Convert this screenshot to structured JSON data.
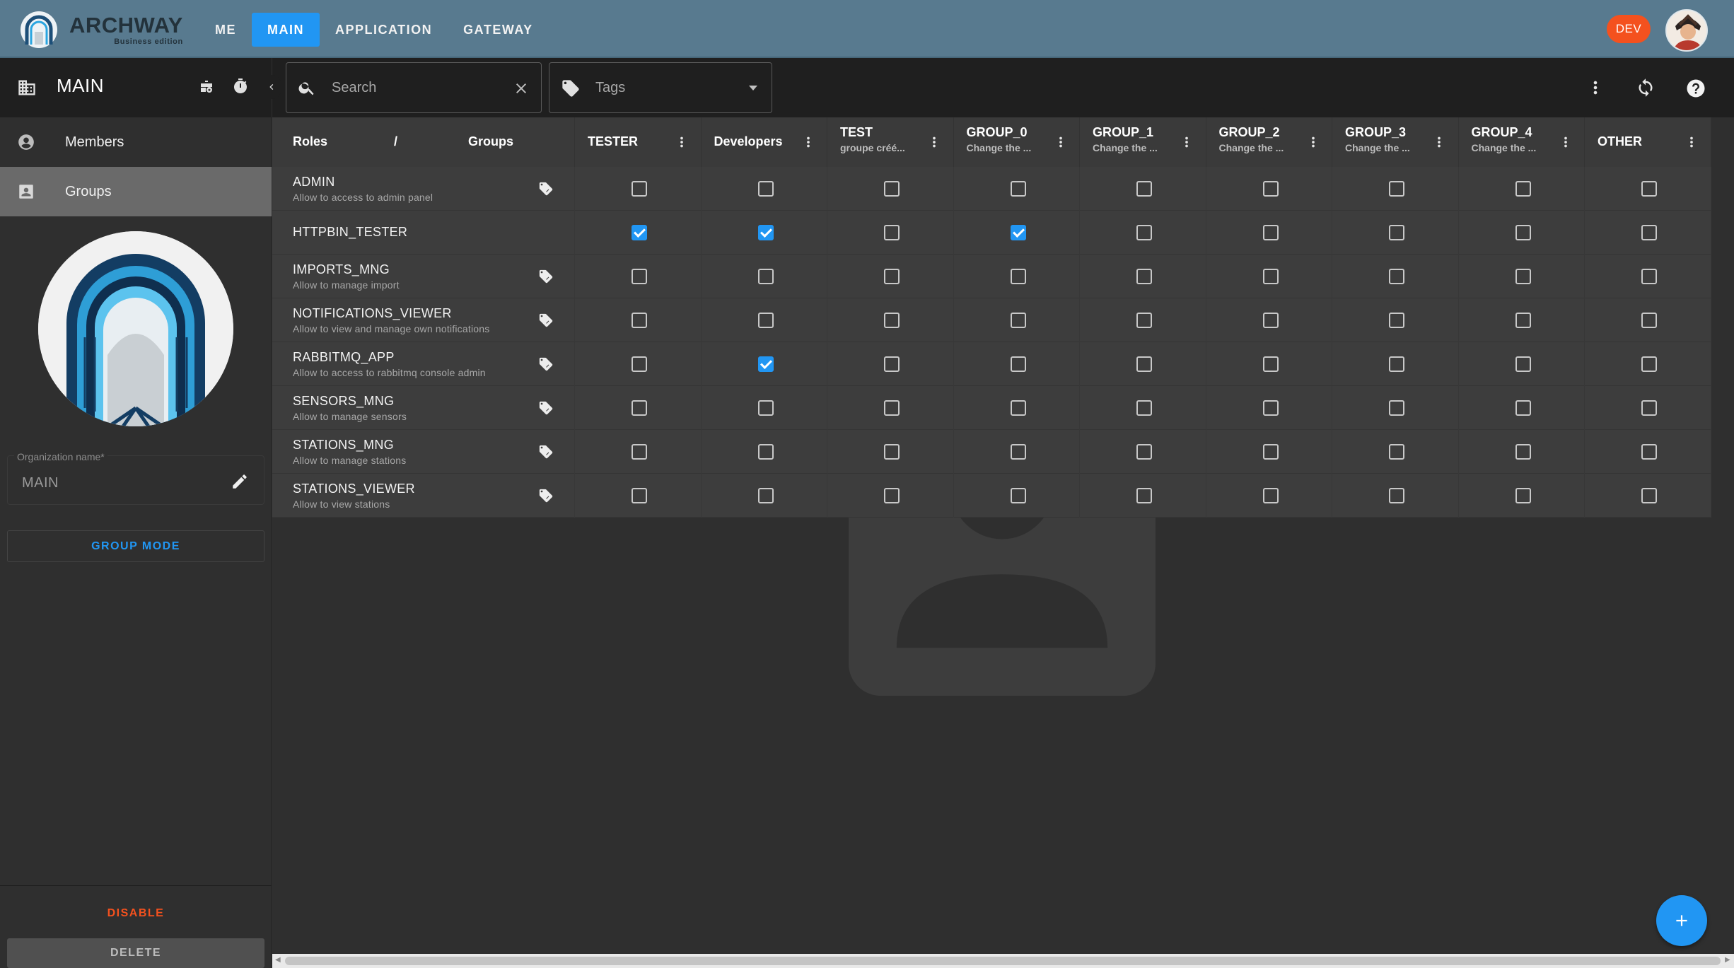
{
  "brand": {
    "name": "ARCHWAY",
    "edition": "Business edition"
  },
  "nav": [
    {
      "label": "ME",
      "active": false
    },
    {
      "label": "MAIN",
      "active": true
    },
    {
      "label": "APPLICATION",
      "active": false
    },
    {
      "label": "GATEWAY",
      "active": false
    }
  ],
  "env_badge": "DEV",
  "sidebar": {
    "title": "MAIN",
    "menu": [
      {
        "label": "Members",
        "icon": "account-circle-icon",
        "active": false
      },
      {
        "label": "Groups",
        "icon": "group-badge-icon",
        "active": true
      }
    ],
    "org_field": {
      "label": "Organization name*",
      "value": "MAIN"
    },
    "group_mode_label": "GROUP MODE",
    "disable_label": "DISABLE",
    "delete_label": "DELETE"
  },
  "toolbar": {
    "search_placeholder": "Search",
    "tags_label": "Tags"
  },
  "table": {
    "corner": {
      "roles": "Roles",
      "separator": "/",
      "groups": "Groups"
    },
    "groups": [
      {
        "name": "TESTER",
        "desc": ""
      },
      {
        "name": "Developers",
        "desc": ""
      },
      {
        "name": "TEST",
        "desc": "groupe créé..."
      },
      {
        "name": "GROUP_0",
        "desc": "Change the ..."
      },
      {
        "name": "GROUP_1",
        "desc": "Change the ..."
      },
      {
        "name": "GROUP_2",
        "desc": "Change the ..."
      },
      {
        "name": "GROUP_3",
        "desc": "Change the ..."
      },
      {
        "name": "GROUP_4",
        "desc": "Change the ..."
      },
      {
        "name": "OTHER",
        "desc": ""
      }
    ],
    "roles": [
      {
        "name": "ADMIN",
        "desc": "Allow to access to admin panel",
        "tag": true,
        "checks": [
          false,
          false,
          false,
          false,
          false,
          false,
          false,
          false,
          false
        ]
      },
      {
        "name": "HTTPBIN_TESTER",
        "desc": "",
        "tag": false,
        "checks": [
          true,
          true,
          false,
          true,
          false,
          false,
          false,
          false,
          false
        ]
      },
      {
        "name": "IMPORTS_MNG",
        "desc": "Allow to manage import",
        "tag": true,
        "checks": [
          false,
          false,
          false,
          false,
          false,
          false,
          false,
          false,
          false
        ]
      },
      {
        "name": "NOTIFICATIONS_VIEWER",
        "desc": "Allow to view and manage own notifications",
        "tag": true,
        "checks": [
          false,
          false,
          false,
          false,
          false,
          false,
          false,
          false,
          false
        ]
      },
      {
        "name": "RABBITMQ_APP",
        "desc": "Allow to access to rabbitmq console admin",
        "tag": true,
        "checks": [
          false,
          true,
          false,
          false,
          false,
          false,
          false,
          false,
          false
        ]
      },
      {
        "name": "SENSORS_MNG",
        "desc": "Allow to manage sensors",
        "tag": true,
        "checks": [
          false,
          false,
          false,
          false,
          false,
          false,
          false,
          false,
          false
        ]
      },
      {
        "name": "STATIONS_MNG",
        "desc": "Allow to manage stations",
        "tag": true,
        "checks": [
          false,
          false,
          false,
          false,
          false,
          false,
          false,
          false,
          false
        ]
      },
      {
        "name": "STATIONS_VIEWER",
        "desc": "Allow to view stations",
        "tag": true,
        "checks": [
          false,
          false,
          false,
          false,
          false,
          false,
          false,
          false,
          false
        ]
      }
    ]
  },
  "colors": {
    "topbar": "#587a8f",
    "accent": "#2196f3",
    "danger": "#f4511e",
    "background": "#2f2f2f"
  }
}
